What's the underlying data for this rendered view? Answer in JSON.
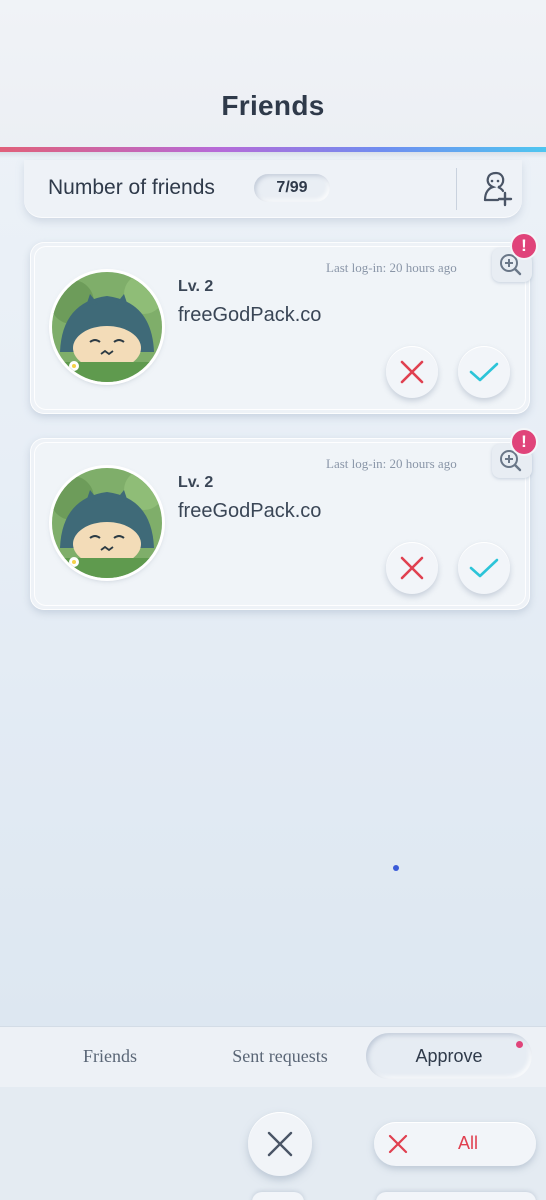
{
  "header": {
    "title": "Friends"
  },
  "summary": {
    "label": "Number of friends",
    "count": "7/99",
    "add_icon": "add-friend-icon"
  },
  "requests": [
    {
      "level": "Lv. 2",
      "name": "freeGodPack.co",
      "last_login": "Last log-in: 20 hours ago",
      "badge": "!"
    },
    {
      "level": "Lv. 2",
      "name": "freeGodPack.co",
      "last_login": "Last log-in: 20 hours ago",
      "badge": "!"
    }
  ],
  "tabs": {
    "friends": "Friends",
    "sent": "Sent requests",
    "approve": "Approve"
  },
  "footer": {
    "reject_all_label": "All"
  },
  "colors": {
    "accent_red": "#e04050",
    "accent_teal": "#2cc4d8",
    "badge_pink": "#e0447a"
  }
}
